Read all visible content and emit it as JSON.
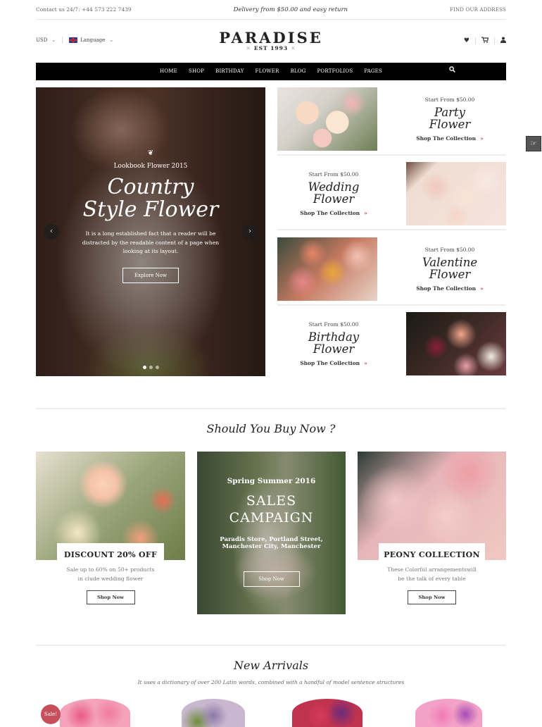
{
  "topbar": {
    "contact": "Contact us 24/7: +44 573 222 7439",
    "delivery": "Delivery from $50.00 and easy return",
    "find_address": "FIND OUR ADDRESS"
  },
  "header": {
    "currency": "USD",
    "language": "Language",
    "logo_name": "PARADISE",
    "logo_est": "EST 1993",
    "icons": [
      "heart-icon",
      "cart-icon",
      "user-icon"
    ]
  },
  "nav": {
    "items": [
      "HOME",
      "SHOP",
      "BIRTHDAY",
      "FLOWER",
      "BLOG",
      "PORTFOLIOS",
      "PAGES"
    ],
    "active": "HOME"
  },
  "hero": {
    "kicker": "Lookbook Flower 2015",
    "title_line1": "Country",
    "title_line2": "Style Flower",
    "description": "It is a long established fact that a reader will be distracted by the readable content of a page when looking at its layout.",
    "button": "Explore Now",
    "slides": 3,
    "active_slide": 1
  },
  "collections": [
    {
      "from": "Start From $50.00",
      "title1": "Party",
      "title2": "Flower",
      "link": "Shop The Collection"
    },
    {
      "from": "Start From $50.00",
      "title1": "Wedding",
      "title2": "Flower",
      "link": "Shop The Collection"
    },
    {
      "from": "Start From $50.00",
      "title1": "Valentine",
      "title2": "Flower",
      "link": "Shop The Collection"
    },
    {
      "from": "Start From $50.00",
      "title1": "Birthday",
      "title2": "Flower",
      "link": "Shop The Collection"
    }
  ],
  "buy_section": {
    "title": "Should You Buy Now ?",
    "discount": {
      "label": "DISCOUNT 20% OFF",
      "desc": "Sale up to 60% on 50+ products in clude wedding flower",
      "button": "Shop Now"
    },
    "campaign": {
      "kicker": "Spring Summer 2016",
      "title1": "SALES",
      "title2": "CAMPAIGN",
      "addr1": "Paradis Store, Portland Street,",
      "addr2": "Manchester City, Manchester",
      "button": "Shop Now"
    },
    "peony": {
      "label": "PEONY COLLECTION",
      "desc": "These Colorful arrangementswill be the talk of every table",
      "button": "Shop Now"
    }
  },
  "new_arrivals": {
    "title": "New Arrivals",
    "subtitle": "It uses a dictionary of over 200 Latin words, combined with a handful of model sentence structures",
    "sale_badge": "Sale!"
  },
  "colors": {
    "accent": "#c64f5b",
    "nav_bg": "#000000"
  }
}
